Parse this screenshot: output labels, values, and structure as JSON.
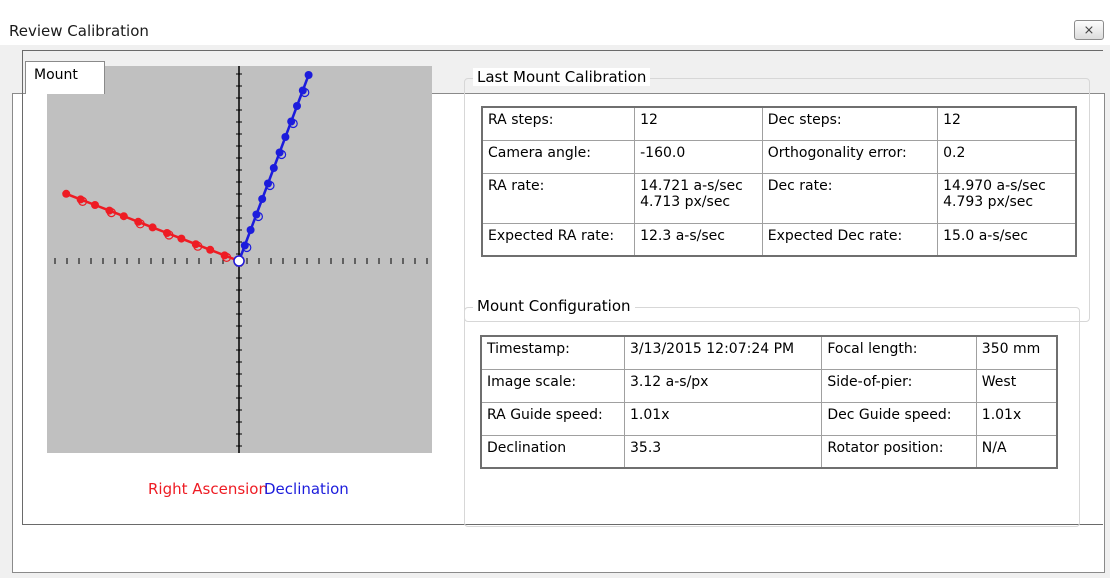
{
  "window": {
    "title": "Review Calibration",
    "close_glyph": "⨯"
  },
  "tabs": [
    {
      "label": "Mount"
    }
  ],
  "plot": {
    "legend": {
      "ra": {
        "label": "Right Ascension",
        "color": "#ee1c24"
      },
      "dec": {
        "label": "Declination",
        "color": "#1c1cdc"
      }
    },
    "background_color": "#c0c0c0"
  },
  "last_calibration": {
    "title": "Last Mount Calibration",
    "rows": [
      {
        "label1": "RA steps:",
        "value1": [
          "12"
        ],
        "label2": "Dec steps:",
        "value2": [
          "12"
        ]
      },
      {
        "label1": "Camera angle:",
        "value1": [
          "-160.0"
        ],
        "label2": "Orthogonality error:",
        "value2": [
          "0.2"
        ]
      },
      {
        "label1": "RA rate:",
        "value1": [
          "14.721 a-s/sec",
          "4.713 px/sec"
        ],
        "label2": "Dec rate:",
        "value2": [
          "14.970 a-s/sec",
          "4.793 px/sec"
        ]
      },
      {
        "label1": "Expected RA rate:",
        "value1": [
          "12.3 a-s/sec"
        ],
        "label2": "Expected Dec rate:",
        "value2": [
          "15.0 a-s/sec"
        ]
      }
    ]
  },
  "mount_configuration": {
    "title": "Mount Configuration",
    "rows": [
      {
        "label1": "Timestamp:",
        "value1": "3/13/2015 12:07:24 PM",
        "label2": "Focal length:",
        "value2": "350 mm"
      },
      {
        "label1": "Image scale:",
        "value1": "3.12 a-s/px",
        "label2": "Side-of-pier:",
        "value2": "West"
      },
      {
        "label1": "RA Guide speed:",
        "value1": "1.01x",
        "label2": "Dec Guide speed:",
        "value2": "1.01x"
      },
      {
        "label1": "Declination",
        "value1": "35.3",
        "label2": "Rotator position:",
        "value2": "N/A"
      }
    ]
  }
}
